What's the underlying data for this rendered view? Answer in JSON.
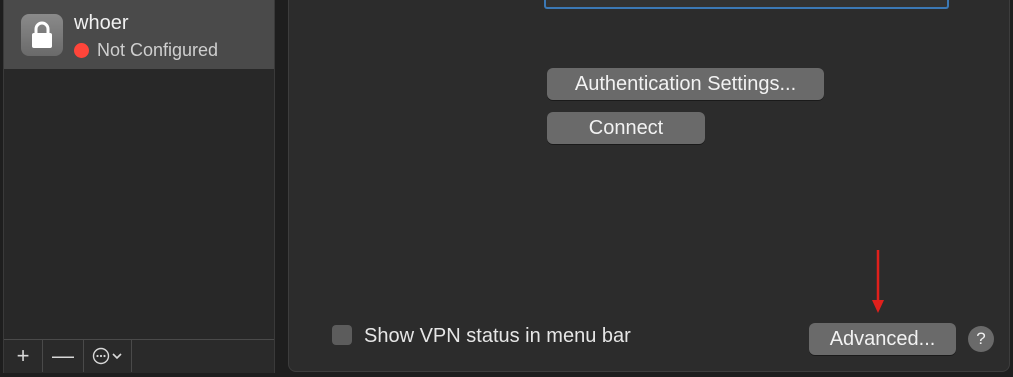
{
  "sidebar": {
    "services": [
      {
        "name": "whoer",
        "status": "Not Configured",
        "status_color": "#ff453a",
        "icon": "lock-icon"
      }
    ],
    "toolbar": {
      "add_label": "+",
      "remove_label": "—",
      "action_icon": "ellipsis-circle-icon"
    }
  },
  "main": {
    "field_label": "",
    "auth_settings_label": "Authentication Settings...",
    "connect_label": "Connect",
    "show_vpn_status_label": "Show VPN status in menu bar",
    "show_vpn_status_checked": false,
    "advanced_label": "Advanced...",
    "help_label": "?"
  },
  "annotation": {
    "arrow_color": "#e0201c"
  },
  "colors": {
    "focus_ring": "#3b78b5",
    "selected_row": "#4a4a4a",
    "button_bg": "#6a6a6a"
  }
}
